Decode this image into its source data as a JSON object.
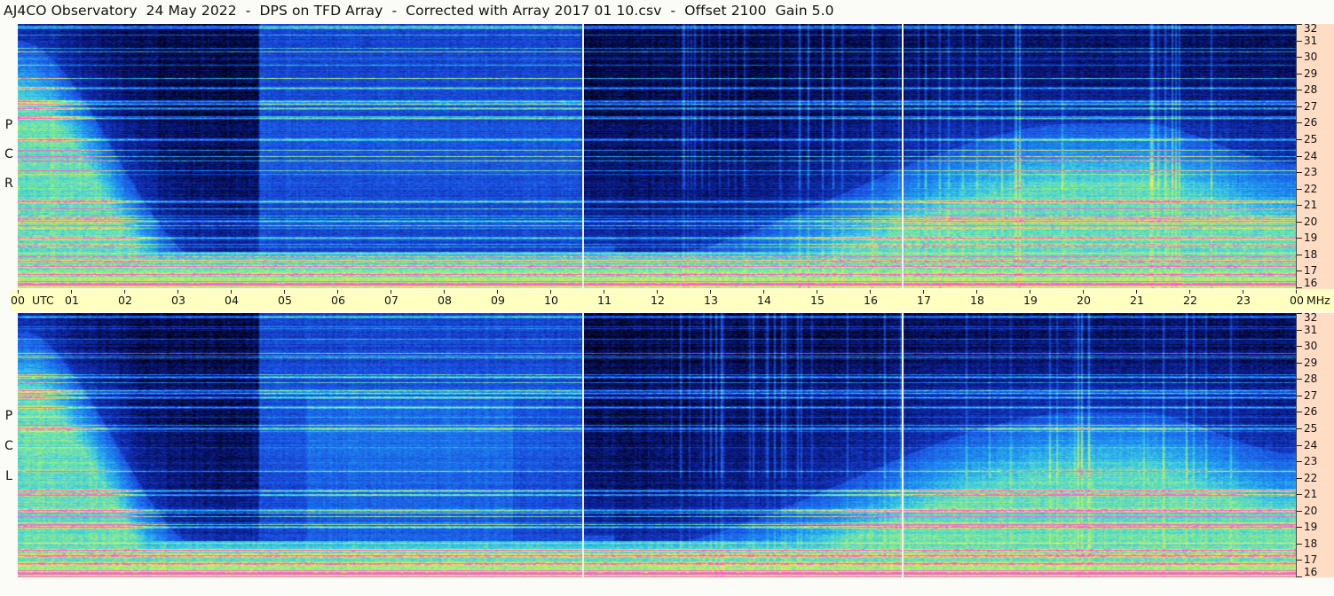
{
  "title": "AJ4CO Observatory  24 May 2022  -  DPS on TFD Array  -  Corrected with Array 2017 01 10.csv  -  Offset 2100  Gain 5.0",
  "chart_data": {
    "type": "heatmap",
    "panels": [
      {
        "label": [
          "R",
          "C",
          "P"
        ],
        "polarization": "RCP"
      },
      {
        "label": [
          "L",
          "C",
          "P"
        ],
        "polarization": "LCP"
      }
    ],
    "x_unit_label": "UTC",
    "x_ticks": [
      "00",
      "01",
      "02",
      "03",
      "04",
      "05",
      "06",
      "07",
      "08",
      "09",
      "10",
      "11",
      "12",
      "13",
      "14",
      "15",
      "16",
      "17",
      "18",
      "19",
      "20",
      "21",
      "22",
      "23",
      "00"
    ],
    "x_range_hours": [
      0,
      24
    ],
    "y_unit_label": "MHz",
    "y_ticks": [
      "32",
      "31",
      "30",
      "29",
      "28",
      "27",
      "26",
      "25",
      "24",
      "23",
      "22",
      "21",
      "20",
      "19",
      "18",
      "17",
      "16"
    ],
    "y_range_mhz": [
      16,
      32
    ],
    "data_gaps_utc": [
      10.6,
      16.6
    ],
    "colormap": [
      "#000010",
      "#0a1c8c",
      "#1a4ee0",
      "#1e90f0",
      "#40d0e0",
      "#a0f07a",
      "#f0f050",
      "#ff60d0"
    ]
  }
}
